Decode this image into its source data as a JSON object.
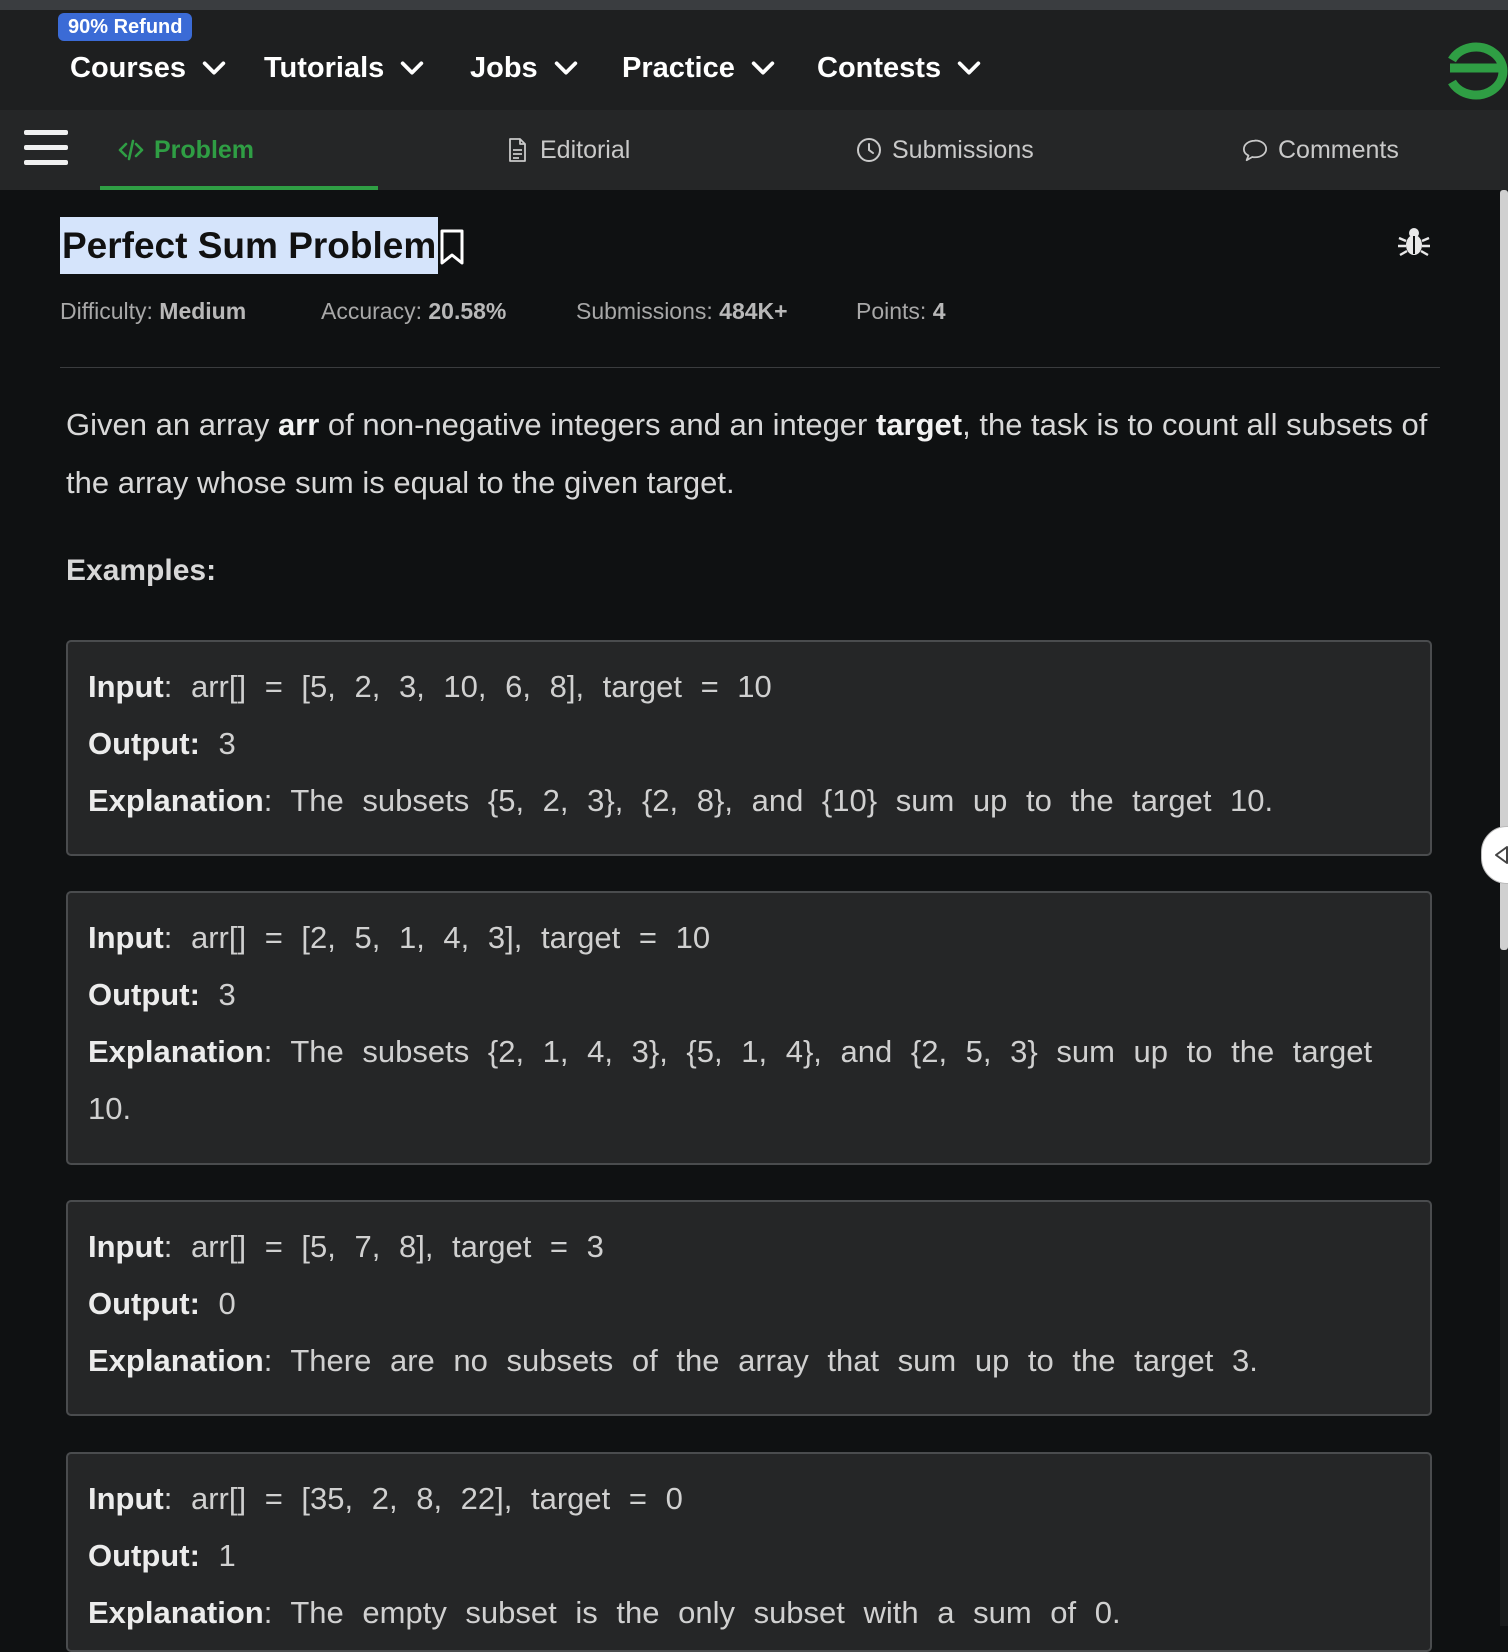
{
  "topnav": {
    "badge": "90% Refund",
    "items": [
      "Courses",
      "Tutorials",
      "Jobs",
      "Practice",
      "Contests"
    ],
    "brand_color": "#2f9e44"
  },
  "tabs": {
    "items": [
      {
        "label": "Problem",
        "icon": "code-icon",
        "active": true
      },
      {
        "label": "Editorial",
        "icon": "document-icon",
        "active": false
      },
      {
        "label": "Submissions",
        "icon": "clock-icon",
        "active": false
      },
      {
        "label": "Comments",
        "icon": "chat-bubble-icon",
        "active": false
      }
    ],
    "accent_color": "#2f9e44"
  },
  "problem": {
    "title": "Perfect Sum Problem",
    "difficulty_label": "Difficulty:",
    "difficulty": "Medium",
    "accuracy_label": "Accuracy:",
    "accuracy": "20.58%",
    "submissions_label": "Submissions:",
    "submissions": "484K+",
    "points_label": "Points:",
    "points": "4",
    "description": {
      "p1": "Given an array ",
      "b1": "arr",
      "p2": " of non-negative integers and an integer ",
      "b2": "target",
      "p3": ", the task is to count all subsets of the array whose sum is equal to the given target."
    },
    "examples_heading": "Examples:",
    "labels": {
      "input": "Input",
      "output": "Output:",
      "explanation": "Explanation"
    },
    "examples": [
      {
        "input": ": arr[] = [5, 2, 3, 10, 6, 8], target = 10",
        "output": " 3",
        "explanation": ": The subsets {5, 2, 3}, {2, 8}, and {10} sum up to the target 10."
      },
      {
        "input": ": arr[] = [2, 5, 1, 4, 3], target = 10",
        "output": " 3",
        "explanation": ": The subsets {2, 1, 4, 3}, {5, 1, 4}, and {2, 5, 3} sum up to the target 10."
      },
      {
        "input": ": arr[] = [5, 7, 8], target = 3",
        "output": " 0",
        "explanation": ": There are no subsets of the array that sum up to the target 3."
      },
      {
        "input": ": arr[] = [35, 2, 8, 22], target = 0",
        "output": " 1",
        "explanation": ": The empty subset is the only subset with a sum of 0."
      }
    ]
  }
}
